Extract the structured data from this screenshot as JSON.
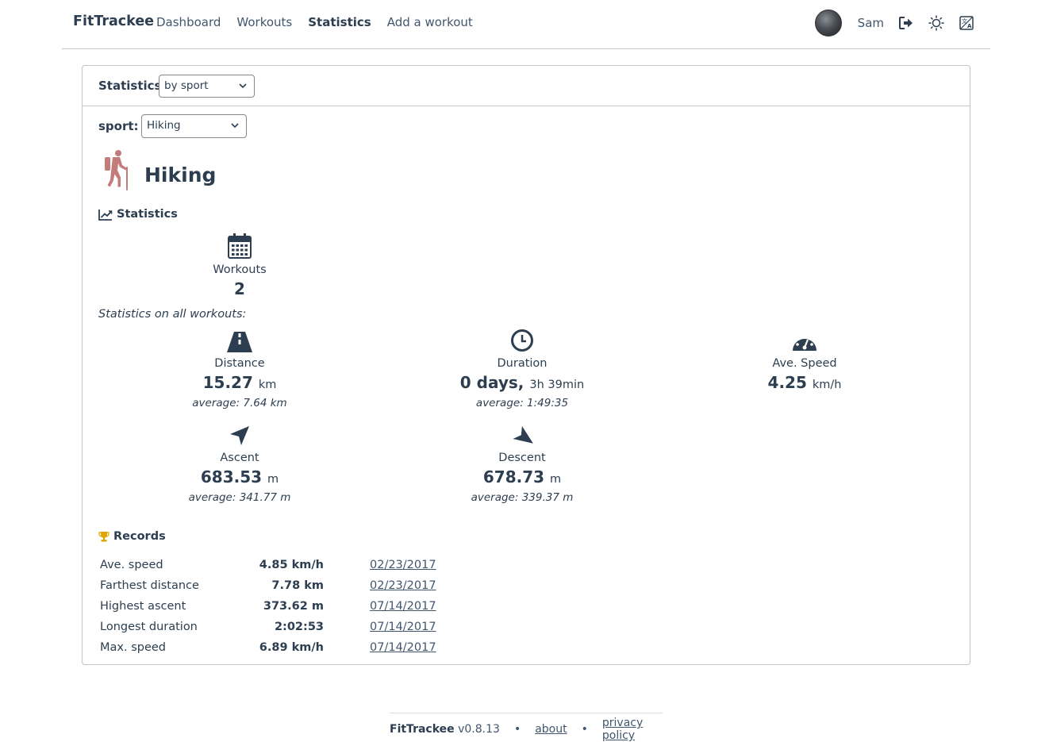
{
  "navbar": {
    "brand": "FitTrackee",
    "links": [
      "Dashboard",
      "Workouts",
      "Statistics",
      "Add a workout"
    ],
    "username": "Sam",
    "icons": [
      "avatar",
      "logout-icon",
      "sun-icon",
      "language-icon"
    ]
  },
  "card": {
    "title": "Statistics",
    "stats_type_selected": "by sport",
    "sport_label": "sport:",
    "sport_selected": "Hiking",
    "sport_name": "Hiking",
    "sport_color": "#c27d7a",
    "statistics_title": "Statistics",
    "workouts": {
      "label": "Workouts",
      "value": "2"
    },
    "all_workouts_label": "Statistics on all workouts:",
    "distance": {
      "label": "Distance",
      "value": "15.27",
      "unit": "km",
      "average": "average: 7.64 km"
    },
    "duration": {
      "label": "Duration",
      "days": "0 days,",
      "rest": "3h 39min",
      "average": "average: 1:49:35"
    },
    "ave_speed": {
      "label": "Ave. Speed",
      "value": "4.25",
      "unit": "km/h"
    },
    "ascent": {
      "label": "Ascent",
      "value": "683.53",
      "unit": "m",
      "average": "average: 341.77 m"
    },
    "descent": {
      "label": "Descent",
      "value": "678.73",
      "unit": "m",
      "average": "average: 339.37 m"
    },
    "records_title": "Records",
    "trophy_color": "#e0a500",
    "records": [
      {
        "label": "Ave. speed",
        "value": "4.85 km/h",
        "date": "02/23/2017"
      },
      {
        "label": "Farthest distance",
        "value": "7.78 km",
        "date": "02/23/2017"
      },
      {
        "label": "Highest ascent",
        "value": "373.62 m",
        "date": "07/14/2017"
      },
      {
        "label": "Longest duration",
        "value": "2:02:53",
        "date": "07/14/2017"
      },
      {
        "label": "Max. speed",
        "value": "6.89 km/h",
        "date": "07/14/2017"
      }
    ]
  },
  "footer": {
    "app": "FitTrackee",
    "version": "v0.8.13",
    "about": "about",
    "privacy": "privacy policy"
  }
}
